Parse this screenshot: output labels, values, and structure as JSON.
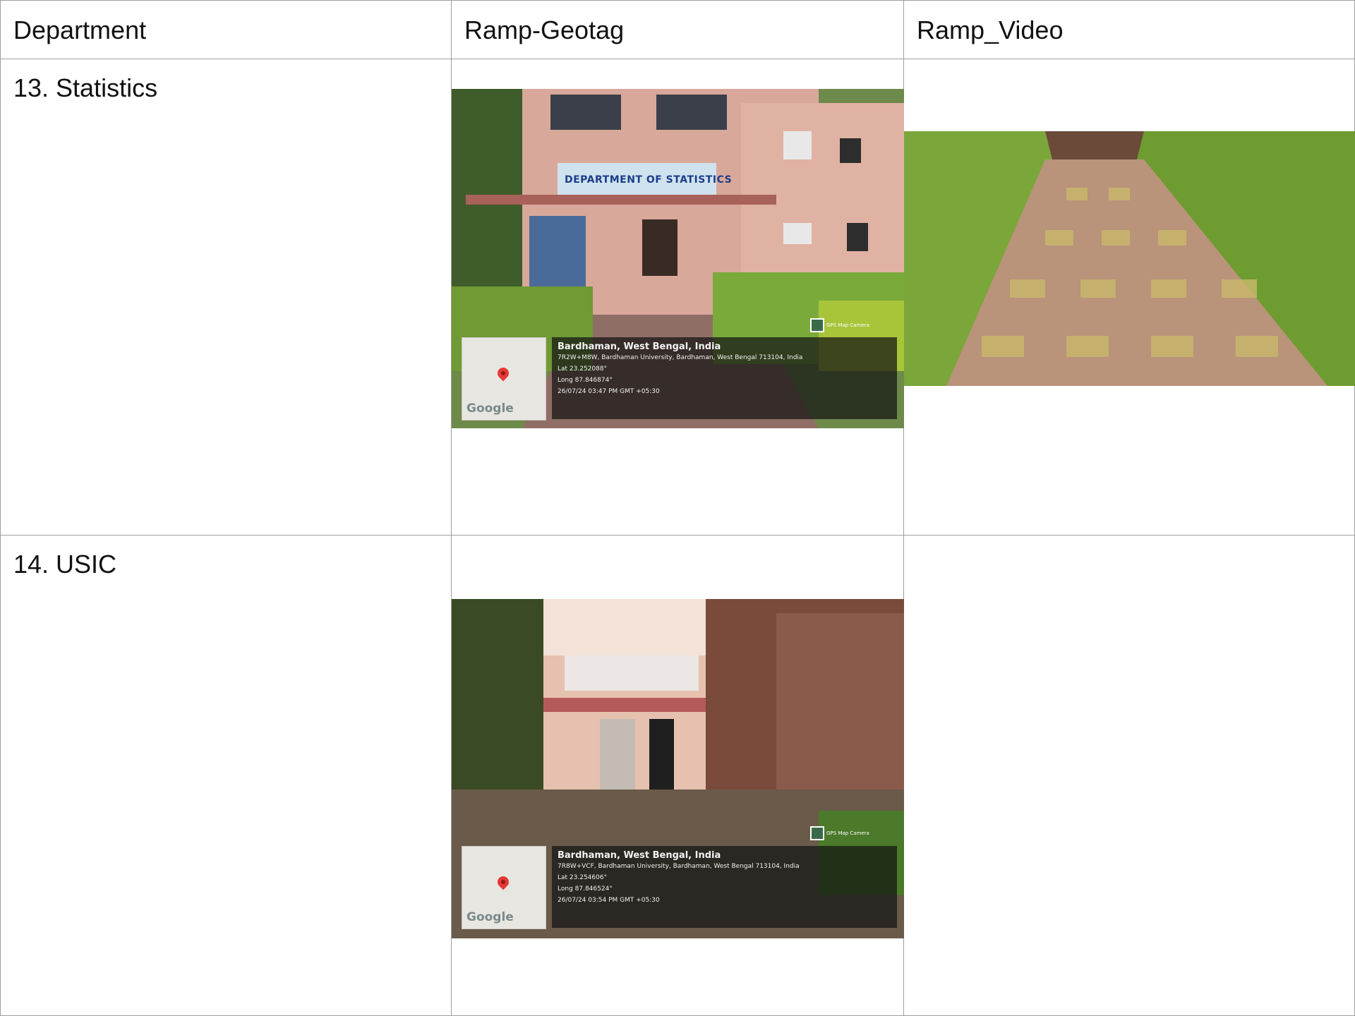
{
  "table": {
    "headers": [
      "Department",
      "Ramp-Geotag",
      "Ramp_Video"
    ],
    "rows": [
      {
        "department": "13. Statistics",
        "geotag": {
          "sign": "DEPARTMENT OF STATISTICS",
          "map_logo": "Google",
          "badge": "GPS Map Camera",
          "lines": [
            "Bardhaman, West Bengal, India",
            "7R2W+M8W, Bardhaman University, Bardhaman, West Bengal 713104, India",
            "Lat 23.252088°",
            "Long 87.846874°",
            "26/07/24 03:47 PM GMT +05:30"
          ]
        },
        "video_icon": "walkway-photo"
      },
      {
        "department": "14. USIC",
        "geotag": {
          "map_logo": "Google",
          "badge": "GPS Map Camera",
          "lines": [
            "Bardhaman, West Bengal, India",
            "7R8W+VCF, Bardhaman University, Bardhaman, West Bengal 713104, India",
            "Lat 23.254606°",
            "Long 87.846524°",
            "26/07/24 03:54 PM GMT +05:30"
          ]
        }
      }
    ]
  },
  "colors": {
    "border": "#9e9e9e",
    "overlay": "#141414",
    "pin": "#e53935"
  }
}
